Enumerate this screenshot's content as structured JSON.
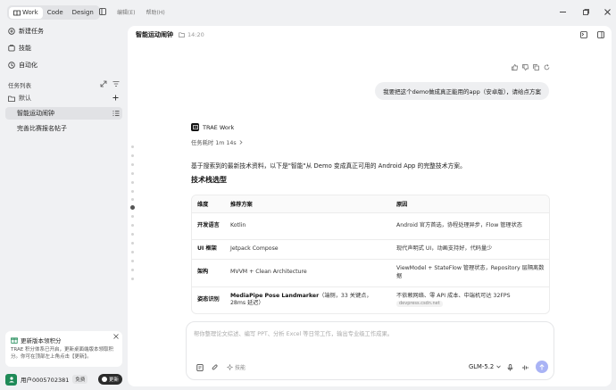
{
  "titlebar": {
    "modes": [
      {
        "label": "Work",
        "active": true
      },
      {
        "label": "Code",
        "active": false
      },
      {
        "label": "Design",
        "active": false
      }
    ],
    "menu": [
      "编辑(E)",
      "帮助(H)"
    ]
  },
  "sidebar": {
    "nav": [
      {
        "label": "新建任务",
        "icon": "new-task-icon"
      },
      {
        "label": "技能",
        "icon": "skills-icon"
      },
      {
        "label": "自动化",
        "icon": "automation-icon"
      }
    ],
    "tasks_title": "任务列表",
    "folder": "默认",
    "tasks": [
      {
        "label": "智能运动闹钟",
        "selected": true
      },
      {
        "label": "完善比赛报名帖子",
        "selected": false
      }
    ],
    "update_card": {
      "title": "更新版本领积分",
      "body": "TRAE 积分体系已开启，更新桌面端版本领取积分。你可在顶部左上角点击【更新】。"
    },
    "user": {
      "name": "用户0005702381",
      "plan": "免费",
      "update_btn": "更新"
    }
  },
  "header": {
    "title": "智能运动闹钟",
    "time": "14:20"
  },
  "chat": {
    "user_message": "我要把这个demo做成真正能用的app（安卓版），请给点方案",
    "agent_name": "TRAE Work",
    "task_time": "任务耗时 1m 14s",
    "intro": "基于搜索到的最新技术资料，以下是\"智能\"从 Demo 变成真正可用的 Android App 的完整技术方案。",
    "section_title": "技术栈选型",
    "table": {
      "headers": [
        "维度",
        "推荐方案",
        "原因"
      ],
      "rows": [
        {
          "dim": "开发语言",
          "plan": "Kotlin",
          "plan_note": "",
          "reason": "Android 官方首选，协程处理异步，Flow 管理状态",
          "source": ""
        },
        {
          "dim": "UI 框架",
          "plan": "Jetpack Compose",
          "plan_note": "",
          "reason": "现代声明式 UI，动画支持好，代码量少",
          "source": ""
        },
        {
          "dim": "架构",
          "plan": "MVVM + Clean Architecture",
          "plan_note": "",
          "reason": "ViewModel + StateFlow 管理状态，Repository 层隔离数据",
          "source": ""
        },
        {
          "dim": "姿态识别",
          "plan": "MediaPipe Pose Landmarker",
          "plan_note": "（端侧，33 关键点，28ms 延迟）",
          "reason": "不依赖网络、零 API 成本、中端机可达 32FPS",
          "source": "devpress.csdn.net"
        }
      ]
    }
  },
  "composer": {
    "placeholder": "帮你整理论文综述、编写 PPT、分析 Excel 等日常工作，输出专业级工作成果。",
    "skills_label": "技能",
    "model": "GLM-5.2"
  },
  "colors": {
    "accent": "#1f8a57",
    "send": "#a9b3f5",
    "bg": "#f0f1f3"
  }
}
